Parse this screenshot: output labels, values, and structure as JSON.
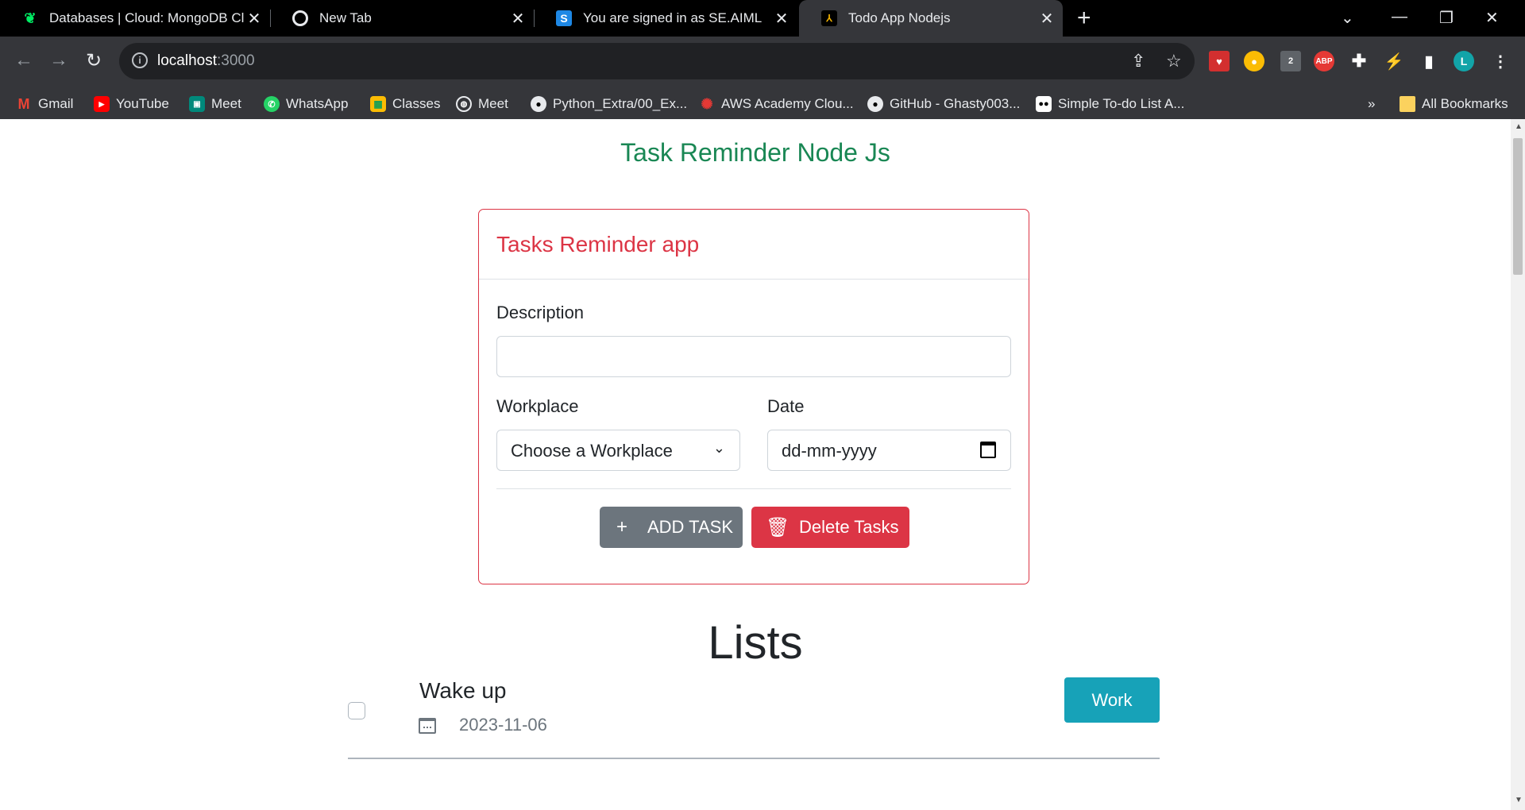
{
  "browser": {
    "tabs": [
      {
        "title": "Databases | Cloud: MongoDB Cl",
        "favicon": "mongodb-leaf-icon"
      },
      {
        "title": "New Tab",
        "favicon": "chrome-icon"
      },
      {
        "title": "You are signed in as SE.AIML",
        "favicon": "s-logo-icon"
      },
      {
        "title": "Todo App Nodejs",
        "favicon": "todo-app-icon"
      }
    ],
    "close_glyph": "✕",
    "new_tab_glyph": "+",
    "address": {
      "host": "localhost",
      "port": ":3000"
    },
    "extension_badge": "2",
    "abp_label": "ABP",
    "profile_initial": "L",
    "bookmarks": [
      {
        "label": "Gmail",
        "icon": "gmail-icon"
      },
      {
        "label": "YouTube",
        "icon": "youtube-icon"
      },
      {
        "label": "Meet",
        "icon": "meet-icon"
      },
      {
        "label": "WhatsApp",
        "icon": "whatsapp-icon"
      },
      {
        "label": "Classes",
        "icon": "classroom-icon"
      },
      {
        "label": "Meet",
        "icon": "globe-icon"
      },
      {
        "label": "Python_Extra/00_Ex...",
        "icon": "github-icon"
      },
      {
        "label": "AWS Academy Clou...",
        "icon": "aws-academy-icon"
      },
      {
        "label": "GitHub - Ghasty003...",
        "icon": "github-icon"
      },
      {
        "label": "Simple To-do List A...",
        "icon": "medium-icon"
      }
    ],
    "bookmarks_overflow": "»",
    "all_bookmarks": "All Bookmarks"
  },
  "page": {
    "heading": "Task Reminder Node Js",
    "card_title": "Tasks Reminder app",
    "description_label": "Description",
    "description_value": "",
    "workplace_label": "Workplace",
    "workplace_selected": "Choose a Workplace",
    "date_label": "Date",
    "date_placeholder": "dd-mm-yyyy",
    "add_button": "ADD TASK",
    "delete_button": "Delete Tasks",
    "lists_heading": "Lists",
    "tasks": [
      {
        "name": "Wake up",
        "date": "2023-11-06",
        "workplace": "Work",
        "checked": false
      }
    ]
  },
  "colors": {
    "heading": "#198754",
    "card_accent": "#dc3545",
    "add_button": "#6c757d",
    "badge": "#17a2b8"
  }
}
